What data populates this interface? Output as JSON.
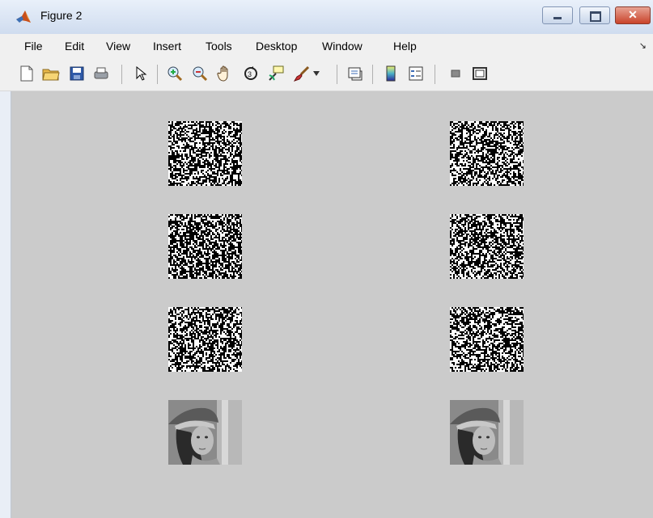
{
  "window": {
    "title": "Figure 2",
    "app_icon": "matlab-icon",
    "controls": [
      "minimize-icon",
      "maximize-icon",
      "close-icon"
    ]
  },
  "menu": {
    "items": [
      "File",
      "Edit",
      "View",
      "Insert",
      "Tools",
      "Desktop",
      "Window",
      "Help"
    ],
    "dock_glyph": "dock-arrow-icon"
  },
  "toolbar": {
    "buttons": [
      "new-figure-icon",
      "open-file-icon",
      "save-figure-icon",
      "print-figure-icon",
      "edit-plot-icon",
      "zoom-in-icon",
      "zoom-out-icon",
      "pan-icon",
      "rotate-3d-icon",
      "data-cursor-icon",
      "brush-icon",
      "brush-dropdown-icon",
      "link-plot-icon",
      "insert-colorbar-icon",
      "insert-legend-icon",
      "hide-plot-tools-icon",
      "show-plot-tools-icon"
    ]
  },
  "figure": {
    "background": "#cbcbcb",
    "tiles": [
      {
        "row": 1,
        "col": 1,
        "kind": "noise"
      },
      {
        "row": 1,
        "col": 2,
        "kind": "noise"
      },
      {
        "row": 2,
        "col": 1,
        "kind": "noise"
      },
      {
        "row": 2,
        "col": 2,
        "kind": "noise"
      },
      {
        "row": 3,
        "col": 1,
        "kind": "noise"
      },
      {
        "row": 3,
        "col": 2,
        "kind": "noise"
      },
      {
        "row": 4,
        "col": 1,
        "kind": "photo"
      },
      {
        "row": 4,
        "col": 2,
        "kind": "photo"
      }
    ]
  }
}
